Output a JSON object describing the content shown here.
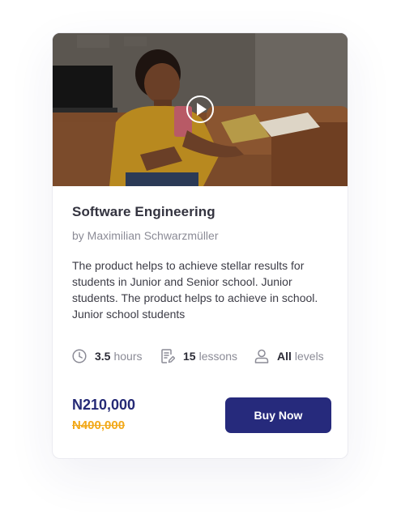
{
  "course": {
    "title": "Software Engineering",
    "author": "by Maximilian Schwarzmüller",
    "description": "The product helps to achieve stellar results for students in Junior and Senior school. Junior students. The product helps to achieve in school. Junior school students",
    "image_alt": "Woman sitting on a couch smiling at her phone"
  },
  "meta": {
    "duration_value": "3.5",
    "duration_unit": "hours",
    "lessons_value": "15",
    "lessons_unit": "lessons",
    "level_value": "All",
    "level_unit": "levels"
  },
  "pricing": {
    "current": "N210,000",
    "original": "N400,000",
    "buy_label": "Buy Now"
  },
  "icons": {
    "play": "play-icon",
    "duration": "clock-icon",
    "lessons": "document-edit-icon",
    "level": "user-icon"
  },
  "colors": {
    "primary": "#262a7c",
    "price": "#252a76",
    "old_price": "#f2a91a",
    "title": "#33333f",
    "muted": "#8b8b96"
  }
}
